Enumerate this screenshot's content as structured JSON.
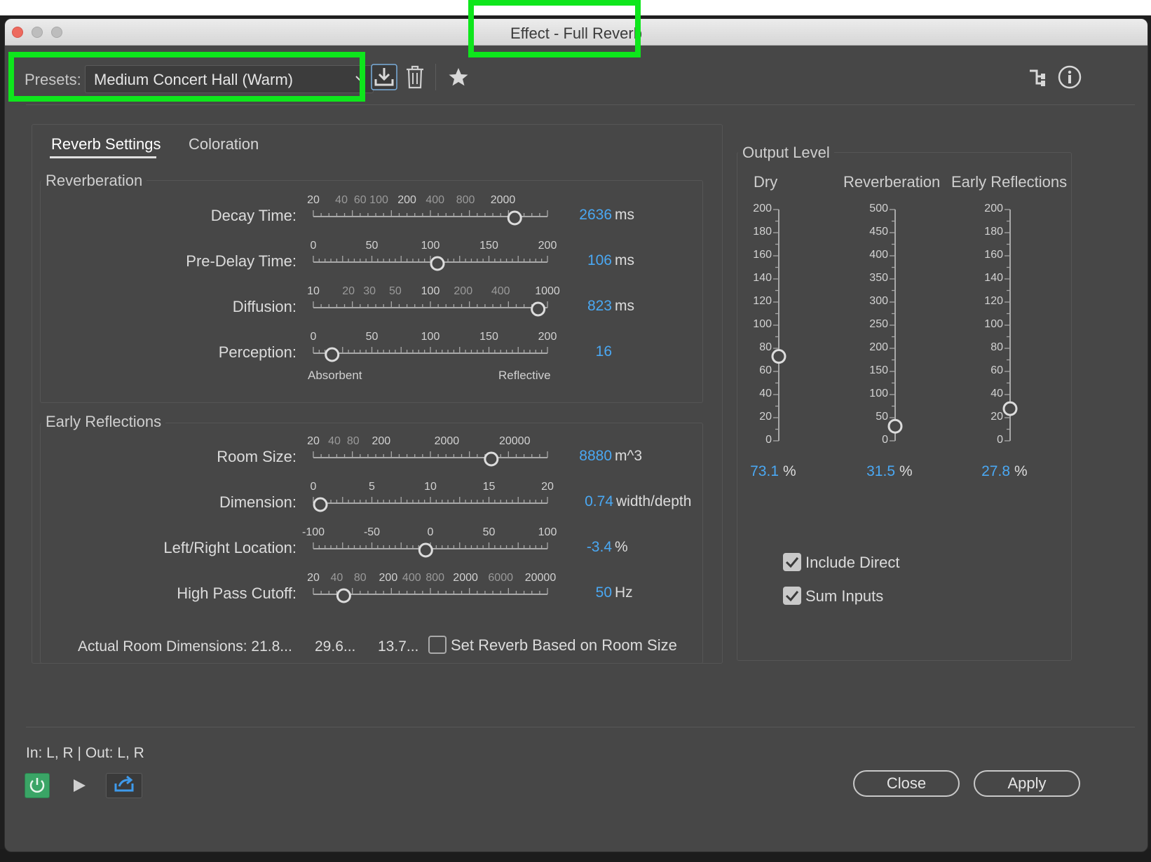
{
  "window": {
    "title": "Effect - Full Reverb"
  },
  "presets": {
    "label": "Presets:",
    "selected": "Medium Concert Hall (Warm)"
  },
  "tabs": [
    {
      "label": "Reverb Settings",
      "active": true
    },
    {
      "label": "Coloration",
      "active": false
    }
  ],
  "reverberation": {
    "title": "Reverberation",
    "decay_time": {
      "label": "Decay Time:",
      "value": "2636",
      "unit": "ms",
      "ticks": [
        "20",
        "40",
        "60",
        "100",
        "200",
        "400",
        "800",
        "2000"
      ],
      "level": 0.86
    },
    "pre_delay": {
      "label": "Pre-Delay Time:",
      "value": "106",
      "unit": "ms",
      "ticks": [
        "0",
        "50",
        "100",
        "150",
        "200"
      ],
      "level": 0.53
    },
    "diffusion": {
      "label": "Diffusion:",
      "value": "823",
      "unit": "ms",
      "ticks": [
        "10",
        "20",
        "30",
        "50",
        "100",
        "200",
        "400",
        "1000"
      ],
      "level": 0.96
    },
    "perception": {
      "label": "Perception:",
      "value": "16",
      "unit": "",
      "ticks": [
        "0",
        "50",
        "100",
        "150",
        "200"
      ],
      "level": 0.08,
      "left_caption": "Absorbent",
      "right_caption": "Reflective"
    }
  },
  "early_reflections": {
    "title": "Early Reflections",
    "room_size": {
      "label": "Room Size:",
      "value": "8880",
      "unit": "m^3",
      "ticks": [
        "20",
        "40",
        "80",
        "200",
        "2000",
        "20000"
      ],
      "level": 0.76
    },
    "dimension": {
      "label": "Dimension:",
      "value": "0.74",
      "unit": "width/depth",
      "ticks": [
        "0",
        "5",
        "10",
        "15",
        "20"
      ],
      "level": 0.03
    },
    "lr_location": {
      "label": "Left/Right Location:",
      "value": "-3.4",
      "unit": "%",
      "ticks": [
        "-100",
        "-50",
        "0",
        "50",
        "100"
      ],
      "level": 0.48
    },
    "high_pass": {
      "label": "High Pass Cutoff:",
      "value": "50",
      "unit": "Hz",
      "ticks": [
        "20",
        "40",
        "80",
        "200",
        "400",
        "800",
        "2000",
        "6000",
        "20000"
      ],
      "level": 0.13
    },
    "actual_dims": {
      "label": "Actual Room Dimensions: 21.8...",
      "v2": "29.6...",
      "v3": "13.7..."
    },
    "set_reverb": {
      "label": "Set Reverb Based on Room Size",
      "checked": false
    }
  },
  "output_level": {
    "title": "Output Level",
    "dry": {
      "label": "Dry",
      "value": "73.1",
      "unit": "%",
      "ticks": [
        "200",
        "180",
        "160",
        "140",
        "120",
        "100",
        "80",
        "60",
        "40",
        "20",
        "0"
      ],
      "level": 0.365
    },
    "reverb": {
      "label": "Reverberation",
      "value": "31.5",
      "unit": "%",
      "ticks": [
        "500",
        "450",
        "400",
        "350",
        "300",
        "250",
        "200",
        "150",
        "100",
        "50",
        "0"
      ],
      "level": 0.063
    },
    "early": {
      "label": "Early Reflections",
      "value": "27.8",
      "unit": "%",
      "ticks": [
        "200",
        "180",
        "160",
        "140",
        "120",
        "100",
        "80",
        "60",
        "40",
        "20",
        "0"
      ],
      "level": 0.139
    }
  },
  "options": {
    "include_direct": {
      "label": "Include Direct",
      "checked": true
    },
    "sum_inputs": {
      "label": "Sum  Inputs",
      "checked": true
    }
  },
  "footer": {
    "io": "In: L, R | Out: L, R",
    "close": "Close",
    "apply": "Apply"
  },
  "colors": {
    "accent": "#4aa8f3",
    "highlight": "#0ee61c",
    "power": "#3aa566"
  }
}
